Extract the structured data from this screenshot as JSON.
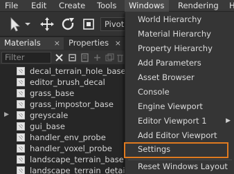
{
  "menubar": {
    "items": [
      {
        "label": "File"
      },
      {
        "label": "Edit"
      },
      {
        "label": "Create"
      },
      {
        "label": "Tools"
      },
      {
        "label": "Windows"
      },
      {
        "label": "Rendering"
      },
      {
        "label": "H"
      }
    ],
    "active": "Windows"
  },
  "toolbar": {
    "pivot_label": "Pivot"
  },
  "panel": {
    "tabs": [
      {
        "label": "Materials",
        "close": "×"
      },
      {
        "label": "Properties",
        "close": "×"
      }
    ],
    "filter_placeholder": "Filter",
    "materials": [
      {
        "name": "decal_terrain_hole_base",
        "expandable": false
      },
      {
        "name": "editor_brush_decal",
        "expandable": false
      },
      {
        "name": "grass_base",
        "expandable": false
      },
      {
        "name": "grass_impostor_base",
        "expandable": false
      },
      {
        "name": "greyscale",
        "expandable": true
      },
      {
        "name": "gui_base",
        "expandable": false
      },
      {
        "name": "handler_env_probe",
        "expandable": false
      },
      {
        "name": "handler_voxel_probe",
        "expandable": false
      },
      {
        "name": "landscape_terrain_base",
        "expandable": false
      },
      {
        "name": "landscape_terrain_detail_b",
        "expandable": false
      }
    ]
  },
  "windows_menu": {
    "items": [
      {
        "label": "World Hierarchy"
      },
      {
        "label": "Material Hierarchy"
      },
      {
        "label": "Property Hierarchy"
      },
      {
        "label": "Add Parameters"
      },
      {
        "label": "Asset Browser"
      },
      {
        "label": "Console"
      },
      {
        "label": "Engine Viewport"
      },
      {
        "label": "Editor Viewport 1",
        "submenu": true
      },
      {
        "label": "Add Editor Viewport"
      },
      {
        "label": "Settings",
        "highlighted": true
      },
      {
        "label": "Reset Windows Layout"
      }
    ],
    "highlight_color": "#e07a1f"
  }
}
